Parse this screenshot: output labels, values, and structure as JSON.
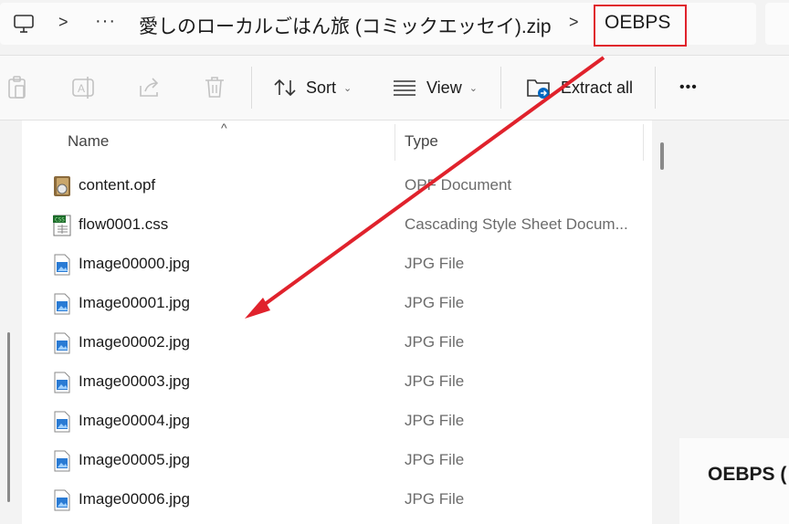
{
  "address_bar": {
    "crumbs": [
      "愛しのローカルごはん旅 (コミックエッセイ).zip",
      "OEBPS"
    ],
    "more_label": "···",
    "separator": ">"
  },
  "toolbar": {
    "sort_label": "Sort",
    "view_label": "View",
    "extract_label": "Extract all",
    "more_label": "•••"
  },
  "columns": {
    "name": "Name",
    "type": "Type"
  },
  "files": [
    {
      "name": "content.opf",
      "type": "OPF Document",
      "icon": "opf-file-icon"
    },
    {
      "name": "flow0001.css",
      "type": "Cascading Style Sheet Docum...",
      "icon": "css-file-icon"
    },
    {
      "name": "Image00000.jpg",
      "type": "JPG File",
      "icon": "jpg-file-icon"
    },
    {
      "name": "Image00001.jpg",
      "type": "JPG File",
      "icon": "jpg-file-icon"
    },
    {
      "name": "Image00002.jpg",
      "type": "JPG File",
      "icon": "jpg-file-icon"
    },
    {
      "name": "Image00003.jpg",
      "type": "JPG File",
      "icon": "jpg-file-icon"
    },
    {
      "name": "Image00004.jpg",
      "type": "JPG File",
      "icon": "jpg-file-icon"
    },
    {
      "name": "Image00005.jpg",
      "type": "JPG File",
      "icon": "jpg-file-icon"
    },
    {
      "name": "Image00006.jpg",
      "type": "JPG File",
      "icon": "jpg-file-icon"
    }
  ],
  "details_pane": {
    "title": "OEBPS ("
  },
  "colors": {
    "annotation": "#e0222c",
    "accent": "#0067c0"
  }
}
